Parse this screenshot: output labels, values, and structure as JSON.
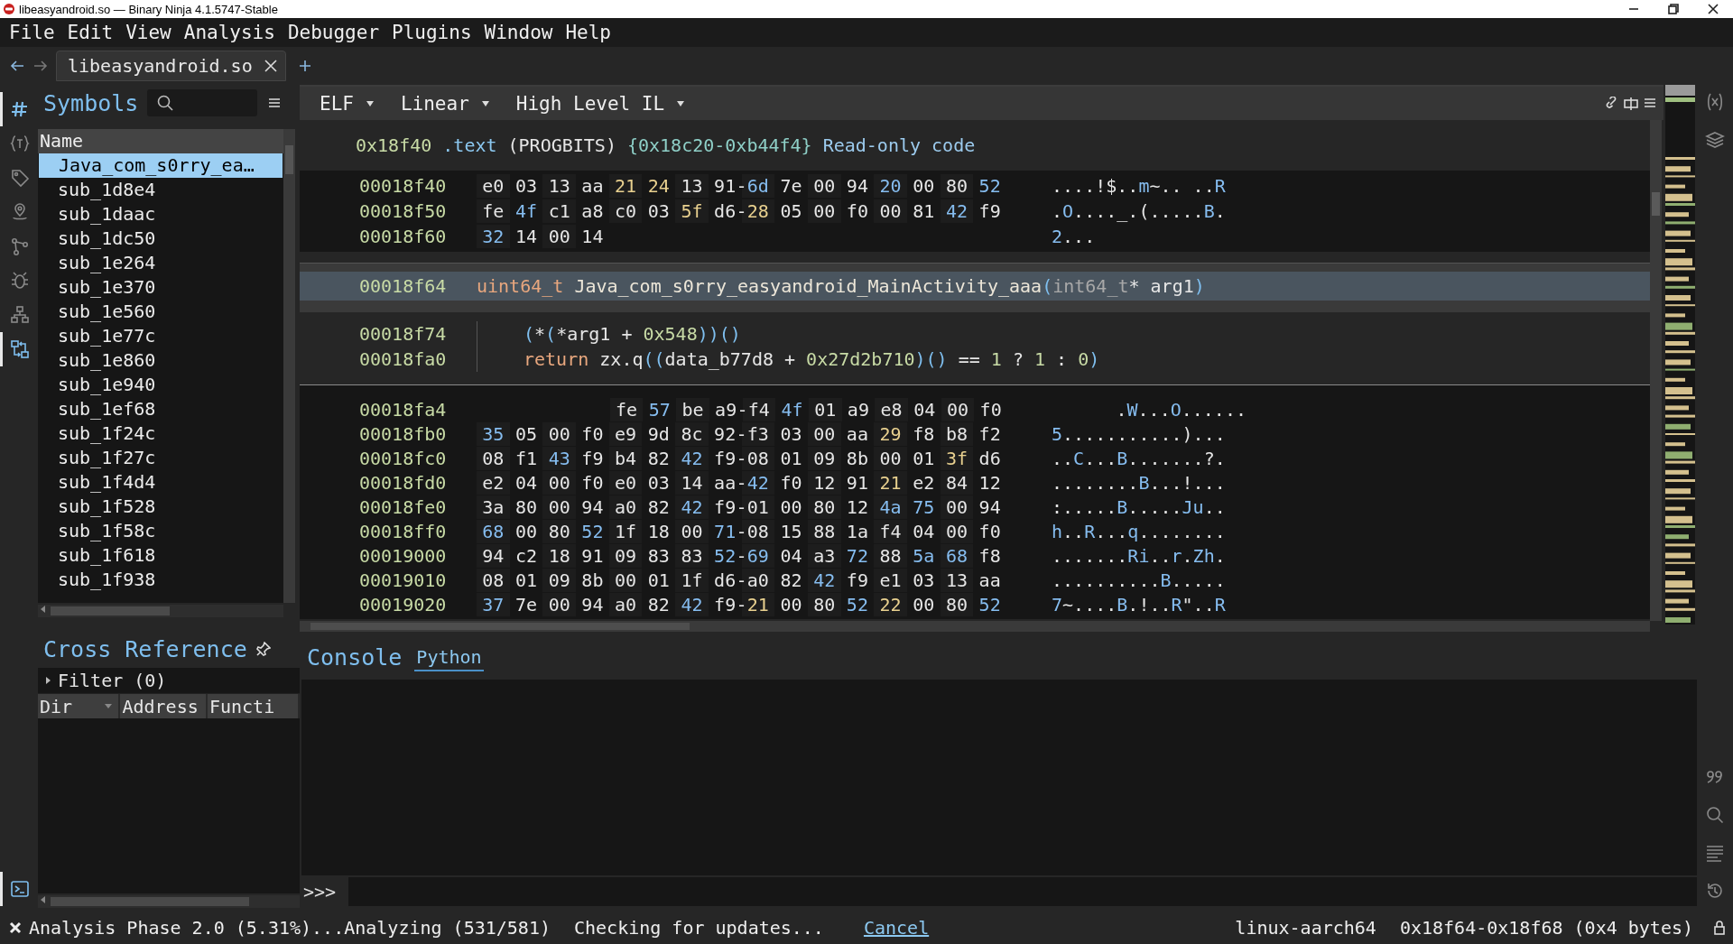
{
  "window": {
    "title": "libeasyandroid.so — Binary Ninja 4.1.5747-Stable"
  },
  "menu": [
    "File",
    "Edit",
    "View",
    "Analysis",
    "Debugger",
    "Plugins",
    "Window",
    "Help"
  ],
  "file_tabs": [
    {
      "label": "libeasyandroid.so",
      "selected": true
    }
  ],
  "left_toolbar": [
    {
      "selected": true
    },
    {
      "selected": false
    },
    {
      "selected": false
    },
    {
      "selected": false
    },
    {
      "selected": false
    },
    {
      "selected": false
    },
    {
      "selected": false
    },
    {
      "selected": true
    },
    {
      "selected": true
    }
  ],
  "symbols": {
    "title": "Symbols",
    "column": "Name",
    "items": [
      {
        "name": "Java_com_s0rry_ea…",
        "selected": true
      },
      {
        "name": "sub_1d8e4",
        "selected": false
      },
      {
        "name": "sub_1daac",
        "selected": false
      },
      {
        "name": "sub_1dc50",
        "selected": false
      },
      {
        "name": "sub_1e264",
        "selected": false
      },
      {
        "name": "sub_1e370",
        "selected": false
      },
      {
        "name": "sub_1e560",
        "selected": false
      },
      {
        "name": "sub_1e77c",
        "selected": false
      },
      {
        "name": "sub_1e860",
        "selected": false
      },
      {
        "name": "sub_1e940",
        "selected": false
      },
      {
        "name": "sub_1ef68",
        "selected": false
      },
      {
        "name": "sub_1f24c",
        "selected": false
      },
      {
        "name": "sub_1f27c",
        "selected": false
      },
      {
        "name": "sub_1f4d4",
        "selected": false
      },
      {
        "name": "sub_1f528",
        "selected": false
      },
      {
        "name": "sub_1f58c",
        "selected": false
      },
      {
        "name": "sub_1f618",
        "selected": false
      },
      {
        "name": "sub_1f938",
        "selected": false
      }
    ]
  },
  "cross_references": {
    "title": "Cross Reference",
    "filter": {
      "label": "Filter (0)",
      "expanded": false
    },
    "columns": [
      "Dir",
      "Address",
      "Functi"
    ]
  },
  "view_bar": {
    "menus": [
      "ELF",
      "Linear",
      "High Level IL"
    ]
  },
  "linear": {
    "section": {
      "address": "0x18f40",
      "tokens": [
        {
          "text": ".text",
          "kind": "section"
        },
        {
          "text": "(PROGBITS)",
          "kind": "plain"
        },
        {
          "text": "{0x18c20-0xb44f4}",
          "kind": "range"
        },
        {
          "text": "Read-only code",
          "kind": "note"
        }
      ]
    },
    "hex_top": [
      {
        "address": "00018f40",
        "ascii": "....!$..m~.. ..R",
        "bytes": [
          {
            "text": "e0",
            "kind": "plain"
          },
          {
            "text": "03",
            "kind": "plain"
          },
          {
            "text": "13",
            "kind": "plain"
          },
          {
            "text": "aa",
            "kind": "plain"
          },
          {
            "text": "21",
            "kind": "punct"
          },
          {
            "text": "24",
            "kind": "punct"
          },
          {
            "text": "13",
            "kind": "plain"
          },
          {
            "text": "91",
            "kind": "plain"
          },
          {
            "text": "-",
            "kind": "dash"
          },
          {
            "text": "6d",
            "kind": "letter"
          },
          {
            "text": "7e",
            "kind": "plain"
          },
          {
            "text": "00",
            "kind": "plain"
          },
          {
            "text": "94",
            "kind": "plain"
          },
          {
            "text": "20",
            "kind": "letter"
          },
          {
            "text": "00",
            "kind": "plain"
          },
          {
            "text": "80",
            "kind": "plain"
          },
          {
            "text": "52",
            "kind": "letter"
          }
        ]
      },
      {
        "address": "00018f50",
        "ascii": ".O...._.(.....B.",
        "bytes": [
          {
            "text": "fe",
            "kind": "plain"
          },
          {
            "text": "4f",
            "kind": "letter"
          },
          {
            "text": "c1",
            "kind": "plain"
          },
          {
            "text": "a8",
            "kind": "plain"
          },
          {
            "text": "c0",
            "kind": "plain"
          },
          {
            "text": "03",
            "kind": "plain"
          },
          {
            "text": "5f",
            "kind": "punct"
          },
          {
            "text": "d6",
            "kind": "plain"
          },
          {
            "text": "-",
            "kind": "dash"
          },
          {
            "text": "28",
            "kind": "punct"
          },
          {
            "text": "05",
            "kind": "plain"
          },
          {
            "text": "00",
            "kind": "plain"
          },
          {
            "text": "f0",
            "kind": "plain"
          },
          {
            "text": "00",
            "kind": "plain"
          },
          {
            "text": "81",
            "kind": "plain"
          },
          {
            "text": "42",
            "kind": "letter"
          },
          {
            "text": "f9",
            "kind": "plain"
          }
        ]
      },
      {
        "address": "00018f60",
        "ascii": "2...",
        "bytes": [
          {
            "text": "32",
            "kind": "letter"
          },
          {
            "text": "14",
            "kind": "plain"
          },
          {
            "text": "00",
            "kind": "plain"
          },
          {
            "text": "14",
            "kind": "plain"
          }
        ]
      }
    ],
    "function": {
      "address": "00018f64",
      "tokens": [
        {
          "text": "uint64_t ",
          "kind": "type"
        },
        {
          "text": "Java_com_s0rry_easyandroid_MainActivity_aaa",
          "kind": "name"
        },
        {
          "text": "(",
          "kind": "paren"
        },
        {
          "text": "int64_t",
          "kind": "muted"
        },
        {
          "text": "* arg1",
          "kind": "plain"
        },
        {
          "text": ")",
          "kind": "paren"
        }
      ]
    },
    "body": [
      {
        "address": "00018f74",
        "tokens": [
          {
            "text": "(",
            "kind": "paren"
          },
          {
            "text": "*",
            "kind": "plain"
          },
          {
            "text": "(",
            "kind": "paren"
          },
          {
            "text": "*arg1 + ",
            "kind": "plain"
          },
          {
            "text": "0x548",
            "kind": "num"
          },
          {
            "text": "))()",
            "kind": "paren"
          }
        ]
      },
      {
        "address": "00018fa0",
        "tokens": [
          {
            "text": "return ",
            "kind": "keyword"
          },
          {
            "text": "zx.q",
            "kind": "plain"
          },
          {
            "text": "((",
            "kind": "paren"
          },
          {
            "text": "data_b77d8 + ",
            "kind": "plain"
          },
          {
            "text": "0x27d2b710",
            "kind": "num"
          },
          {
            "text": ")()",
            "kind": "paren"
          },
          {
            "text": " == ",
            "kind": "plain"
          },
          {
            "text": "1",
            "kind": "num"
          },
          {
            "text": " ? ",
            "kind": "plain"
          },
          {
            "text": "1",
            "kind": "num"
          },
          {
            "text": " : ",
            "kind": "plain"
          },
          {
            "text": "0",
            "kind": "num"
          },
          {
            "text": ")",
            "kind": "paren"
          }
        ]
      }
    ],
    "hex_bottom": [
      {
        "address": "00018fa4",
        "kind": "right",
        "ascii": ".W...O......",
        "bytes": [
          {
            "text": "fe",
            "kind": "plain"
          },
          {
            "text": "57",
            "kind": "letter"
          },
          {
            "text": "be",
            "kind": "plain"
          },
          {
            "text": "a9",
            "kind": "plain"
          },
          {
            "text": "-",
            "kind": "dash"
          },
          {
            "text": "f4",
            "kind": "plain"
          },
          {
            "text": "4f",
            "kind": "letter"
          },
          {
            "text": "01",
            "kind": "plain"
          },
          {
            "text": "a9",
            "kind": "plain"
          },
          {
            "text": "e8",
            "kind": "plain"
          },
          {
            "text": "04",
            "kind": "plain"
          },
          {
            "text": "00",
            "kind": "plain"
          },
          {
            "text": "f0",
            "kind": "plain"
          }
        ]
      },
      {
        "address": "00018fb0",
        "ascii": "5...........)...",
        "bytes": [
          {
            "text": "35",
            "kind": "letter"
          },
          {
            "text": "05",
            "kind": "plain"
          },
          {
            "text": "00",
            "kind": "plain"
          },
          {
            "text": "f0",
            "kind": "plain"
          },
          {
            "text": "e9",
            "kind": "plain"
          },
          {
            "text": "9d",
            "kind": "plain"
          },
          {
            "text": "8c",
            "kind": "plain"
          },
          {
            "text": "92",
            "kind": "plain"
          },
          {
            "text": "-",
            "kind": "dash"
          },
          {
            "text": "f3",
            "kind": "plain"
          },
          {
            "text": "03",
            "kind": "plain"
          },
          {
            "text": "00",
            "kind": "plain"
          },
          {
            "text": "aa",
            "kind": "plain"
          },
          {
            "text": "29",
            "kind": "punct"
          },
          {
            "text": "f8",
            "kind": "plain"
          },
          {
            "text": "b8",
            "kind": "plain"
          },
          {
            "text": "f2",
            "kind": "plain"
          }
        ]
      },
      {
        "address": "00018fc0",
        "ascii": "..C...B.......?.",
        "bytes": [
          {
            "text": "08",
            "kind": "plain"
          },
          {
            "text": "f1",
            "kind": "plain"
          },
          {
            "text": "43",
            "kind": "letter"
          },
          {
            "text": "f9",
            "kind": "plain"
          },
          {
            "text": "b4",
            "kind": "plain"
          },
          {
            "text": "82",
            "kind": "plain"
          },
          {
            "text": "42",
            "kind": "letter"
          },
          {
            "text": "f9",
            "kind": "plain"
          },
          {
            "text": "-",
            "kind": "dash"
          },
          {
            "text": "08",
            "kind": "plain"
          },
          {
            "text": "01",
            "kind": "plain"
          },
          {
            "text": "09",
            "kind": "plain"
          },
          {
            "text": "8b",
            "kind": "plain"
          },
          {
            "text": "00",
            "kind": "plain"
          },
          {
            "text": "01",
            "kind": "plain"
          },
          {
            "text": "3f",
            "kind": "punct"
          },
          {
            "text": "d6",
            "kind": "plain"
          }
        ]
      },
      {
        "address": "00018fd0",
        "ascii": "........B...!...",
        "bytes": [
          {
            "text": "e2",
            "kind": "plain"
          },
          {
            "text": "04",
            "kind": "plain"
          },
          {
            "text": "00",
            "kind": "plain"
          },
          {
            "text": "f0",
            "kind": "plain"
          },
          {
            "text": "e0",
            "kind": "plain"
          },
          {
            "text": "03",
            "kind": "plain"
          },
          {
            "text": "14",
            "kind": "plain"
          },
          {
            "text": "aa",
            "kind": "plain"
          },
          {
            "text": "-",
            "kind": "dash"
          },
          {
            "text": "42",
            "kind": "letter"
          },
          {
            "text": "f0",
            "kind": "plain"
          },
          {
            "text": "12",
            "kind": "plain"
          },
          {
            "text": "91",
            "kind": "plain"
          },
          {
            "text": "21",
            "kind": "punct"
          },
          {
            "text": "e2",
            "kind": "plain"
          },
          {
            "text": "84",
            "kind": "plain"
          },
          {
            "text": "12",
            "kind": "plain"
          }
        ]
      },
      {
        "address": "00018fe0",
        "ascii": ":.....B.....Ju..",
        "bytes": [
          {
            "text": "3a",
            "kind": "plain"
          },
          {
            "text": "80",
            "kind": "plain"
          },
          {
            "text": "00",
            "kind": "plain"
          },
          {
            "text": "94",
            "kind": "plain"
          },
          {
            "text": "a0",
            "kind": "plain"
          },
          {
            "text": "82",
            "kind": "plain"
          },
          {
            "text": "42",
            "kind": "letter"
          },
          {
            "text": "f9",
            "kind": "plain"
          },
          {
            "text": "-",
            "kind": "dash"
          },
          {
            "text": "01",
            "kind": "plain"
          },
          {
            "text": "00",
            "kind": "plain"
          },
          {
            "text": "80",
            "kind": "plain"
          },
          {
            "text": "12",
            "kind": "plain"
          },
          {
            "text": "4a",
            "kind": "letter"
          },
          {
            "text": "75",
            "kind": "letter"
          },
          {
            "text": "00",
            "kind": "plain"
          },
          {
            "text": "94",
            "kind": "plain"
          }
        ]
      },
      {
        "address": "00018ff0",
        "ascii": "h..R...q........",
        "bytes": [
          {
            "text": "68",
            "kind": "letter"
          },
          {
            "text": "00",
            "kind": "plain"
          },
          {
            "text": "80",
            "kind": "plain"
          },
          {
            "text": "52",
            "kind": "letter"
          },
          {
            "text": "1f",
            "kind": "plain"
          },
          {
            "text": "18",
            "kind": "plain"
          },
          {
            "text": "00",
            "kind": "plain"
          },
          {
            "text": "71",
            "kind": "letter"
          },
          {
            "text": "-",
            "kind": "dash"
          },
          {
            "text": "08",
            "kind": "plain"
          },
          {
            "text": "15",
            "kind": "plain"
          },
          {
            "text": "88",
            "kind": "plain"
          },
          {
            "text": "1a",
            "kind": "plain"
          },
          {
            "text": "f4",
            "kind": "plain"
          },
          {
            "text": "04",
            "kind": "plain"
          },
          {
            "text": "00",
            "kind": "plain"
          },
          {
            "text": "f0",
            "kind": "plain"
          }
        ]
      },
      {
        "address": "00019000",
        "ascii": ".......Ri..r.Zh.",
        "bytes": [
          {
            "text": "94",
            "kind": "plain"
          },
          {
            "text": "c2",
            "kind": "plain"
          },
          {
            "text": "18",
            "kind": "plain"
          },
          {
            "text": "91",
            "kind": "plain"
          },
          {
            "text": "09",
            "kind": "plain"
          },
          {
            "text": "83",
            "kind": "plain"
          },
          {
            "text": "83",
            "kind": "plain"
          },
          {
            "text": "52",
            "kind": "letter"
          },
          {
            "text": "-",
            "kind": "dash"
          },
          {
            "text": "69",
            "kind": "letter"
          },
          {
            "text": "04",
            "kind": "plain"
          },
          {
            "text": "a3",
            "kind": "plain"
          },
          {
            "text": "72",
            "kind": "letter"
          },
          {
            "text": "88",
            "kind": "plain"
          },
          {
            "text": "5a",
            "kind": "letter"
          },
          {
            "text": "68",
            "kind": "letter"
          },
          {
            "text": "f8",
            "kind": "plain"
          }
        ]
      },
      {
        "address": "00019010",
        "ascii": "..........B.....",
        "bytes": [
          {
            "text": "08",
            "kind": "plain"
          },
          {
            "text": "01",
            "kind": "plain"
          },
          {
            "text": "09",
            "kind": "plain"
          },
          {
            "text": "8b",
            "kind": "plain"
          },
          {
            "text": "00",
            "kind": "plain"
          },
          {
            "text": "01",
            "kind": "plain"
          },
          {
            "text": "1f",
            "kind": "plain"
          },
          {
            "text": "d6",
            "kind": "plain"
          },
          {
            "text": "-",
            "kind": "dash"
          },
          {
            "text": "a0",
            "kind": "plain"
          },
          {
            "text": "82",
            "kind": "plain"
          },
          {
            "text": "42",
            "kind": "letter"
          },
          {
            "text": "f9",
            "kind": "plain"
          },
          {
            "text": "e1",
            "kind": "plain"
          },
          {
            "text": "03",
            "kind": "plain"
          },
          {
            "text": "13",
            "kind": "plain"
          },
          {
            "text": "aa",
            "kind": "plain"
          }
        ]
      },
      {
        "address": "00019020",
        "ascii": "7~....B.!..R\"..R",
        "bytes": [
          {
            "text": "37",
            "kind": "letter"
          },
          {
            "text": "7e",
            "kind": "plain"
          },
          {
            "text": "00",
            "kind": "plain"
          },
          {
            "text": "94",
            "kind": "plain"
          },
          {
            "text": "a0",
            "kind": "plain"
          },
          {
            "text": "82",
            "kind": "plain"
          },
          {
            "text": "42",
            "kind": "letter"
          },
          {
            "text": "f9",
            "kind": "plain"
          },
          {
            "text": "-",
            "kind": "dash"
          },
          {
            "text": "21",
            "kind": "punct"
          },
          {
            "text": "00",
            "kind": "plain"
          },
          {
            "text": "80",
            "kind": "plain"
          },
          {
            "text": "52",
            "kind": "letter"
          },
          {
            "text": "22",
            "kind": "punct"
          },
          {
            "text": "00",
            "kind": "plain"
          },
          {
            "text": "80",
            "kind": "plain"
          },
          {
            "text": "52",
            "kind": "letter"
          }
        ]
      }
    ]
  },
  "console": {
    "title": "Console",
    "tabs": [
      {
        "label": "Python",
        "selected": true
      }
    ],
    "prompt": ">>>"
  },
  "status_bar": {
    "progress": "Analysis Phase 2.0 (5.31%)...Analyzing (531/581)",
    "updates": "Checking for updates...",
    "cancel": "Cancel",
    "platform": "linux-aarch64",
    "selection": "0x18f64-0x18f68 (0x4 bytes)"
  }
}
